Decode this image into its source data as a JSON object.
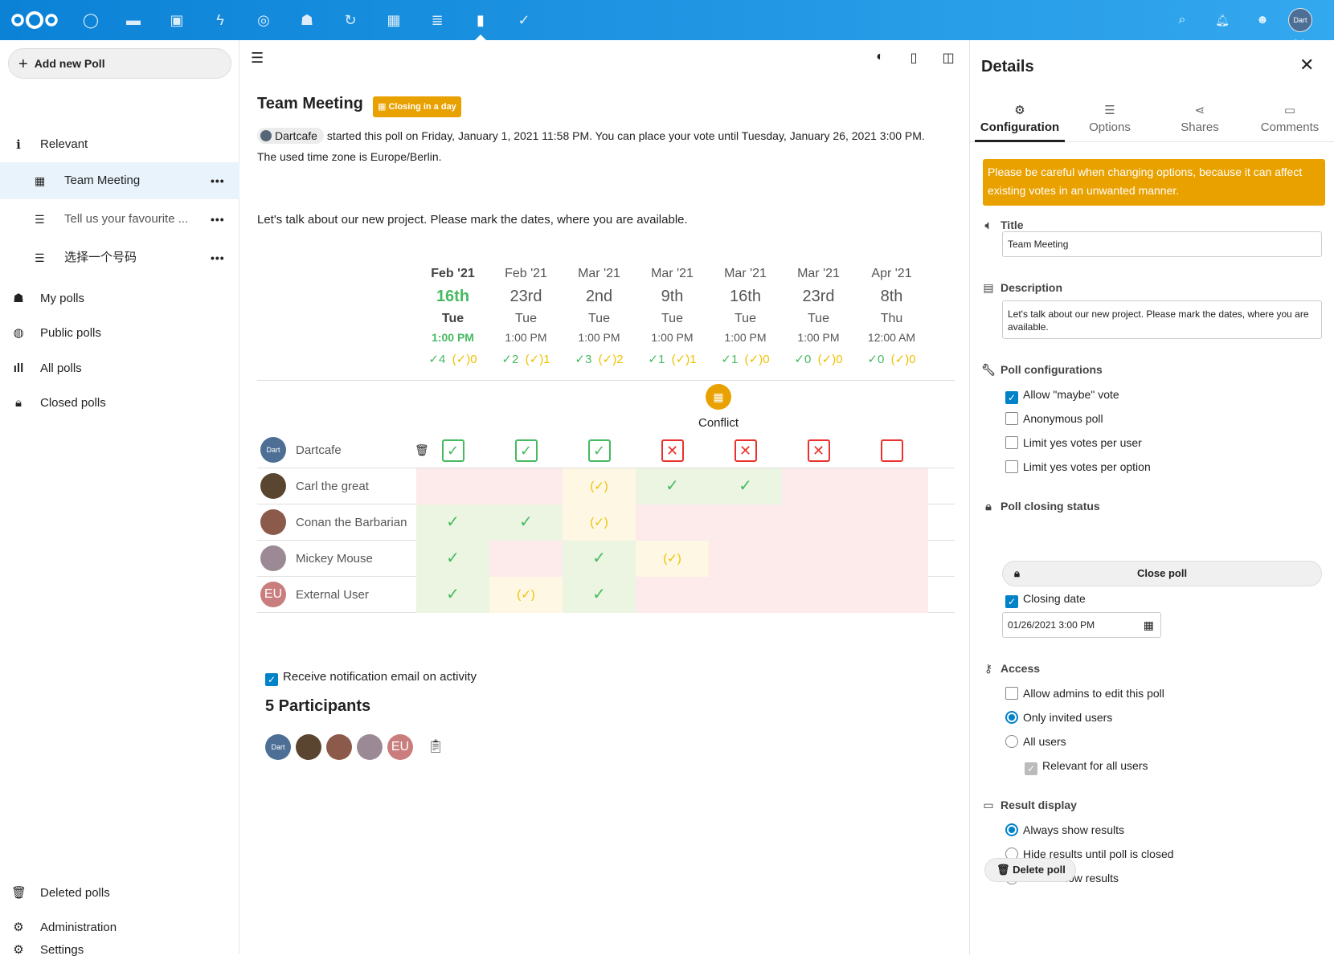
{
  "topbar": {
    "apps": [
      "dashboard-icon",
      "files-icon",
      "photos-icon",
      "activity-icon",
      "talk-icon",
      "contacts-icon",
      "circles-icon",
      "calendar-icon",
      "deck-icon",
      "polls-icon",
      "tasks-icon"
    ],
    "user_avatar_text": "Dart Cafe"
  },
  "leftnav": {
    "add_button": "Add new Poll",
    "relevant": "Relevant",
    "sub_items": [
      {
        "label": "Team Meeting",
        "dots": "•••"
      },
      {
        "label": "Tell us your favourite ...",
        "dots": "•••"
      },
      {
        "label": "选择一个号码",
        "dots": "•••"
      }
    ],
    "my_polls": "My polls",
    "public_polls": "Public polls",
    "all_polls": "All polls",
    "closed_polls": "Closed polls",
    "deleted_polls": "Deleted polls",
    "administration": "Administration",
    "settings": "Settings"
  },
  "poll": {
    "title": "Team Meeting",
    "badge": "Closing in a day",
    "author": "Dartcafe",
    "info_text": "started this poll on Friday, January 1, 2021 11:58 PM. You can place your vote until Tuesday, January 26, 2021 3:00 PM.",
    "timezone_text": "The used time zone is Europe/Berlin.",
    "description": "Let's talk about our new project. Please mark the dates, where you are available.",
    "options": [
      {
        "month": "Feb '21",
        "day": "16th",
        "weekday": "Tue",
        "time": "1:00 PM",
        "yes": "✓4",
        "maybe": "(✓)0"
      },
      {
        "month": "Feb '21",
        "day": "23rd",
        "weekday": "Tue",
        "time": "1:00 PM",
        "yes": "✓2",
        "maybe": "(✓)1"
      },
      {
        "month": "Mar '21",
        "day": "2nd",
        "weekday": "Tue",
        "time": "1:00 PM",
        "yes": "✓3",
        "maybe": "(✓)2"
      },
      {
        "month": "Mar '21",
        "day": "9th",
        "weekday": "Tue",
        "time": "1:00 PM",
        "yes": "✓1",
        "maybe": "(✓)1"
      },
      {
        "month": "Mar '21",
        "day": "16th",
        "weekday": "Tue",
        "time": "1:00 PM",
        "yes": "✓1",
        "maybe": "(✓)0"
      },
      {
        "month": "Mar '21",
        "day": "23rd",
        "weekday": "Tue",
        "time": "1:00 PM",
        "yes": "✓0",
        "maybe": "(✓)0"
      },
      {
        "month": "Apr '21",
        "day": "8th",
        "weekday": "Thu",
        "time": "12:00 AM",
        "yes": "✓0",
        "maybe": "(✓)0"
      }
    ],
    "conflict_label": "Conflict",
    "participants": [
      {
        "name": "Dartcafe",
        "avatar": "Dart",
        "color": "#4d6f95",
        "votes": [
          "yesbox",
          "yesbox",
          "yesbox",
          "nobox",
          "nobox",
          "nobox",
          "emptybox"
        ]
      },
      {
        "name": "Carl the great",
        "avatar": "",
        "color": "#5a4630",
        "votes": [
          "no",
          "no",
          "maybe",
          "yes",
          "yes",
          "no",
          "no"
        ]
      },
      {
        "name": "Conan the Barbarian",
        "avatar": "",
        "color": "#8c5a4a",
        "votes": [
          "yes",
          "yes",
          "maybe",
          "no",
          "no",
          "no",
          "no"
        ]
      },
      {
        "name": "Mickey Mouse",
        "avatar": "",
        "color": "#9b8a95",
        "votes": [
          "yes",
          "no",
          "yes",
          "maybe",
          "no",
          "no",
          "no"
        ]
      },
      {
        "name": "External User",
        "avatar": "EU",
        "color": "#c97d7d",
        "votes": [
          "yes",
          "maybe",
          "yes",
          "no",
          "no",
          "no",
          "no"
        ]
      }
    ],
    "notify_label": "Receive notification email on activity",
    "participants_title": "5 Participants",
    "maybe_symbol": "(✓)",
    "yes_symbol": "✓",
    "no_symbol": "✕"
  },
  "sidebar": {
    "title": "Details",
    "tabs": [
      "Configuration",
      "Options",
      "Shares",
      "Comments"
    ],
    "warning": "Please be careful when changing options, because it can affect existing votes in an unwanted manner.",
    "title_label": "Title",
    "title_value": "Team Meeting",
    "description_label": "Description",
    "description_value": "Let's talk about our new project. Please mark the dates, where you are available.",
    "poll_config_label": "Poll configurations",
    "config_options": [
      {
        "label": "Allow \"maybe\" vote",
        "checked": true
      },
      {
        "label": "Anonymous poll",
        "checked": false
      },
      {
        "label": "Limit yes votes per user",
        "checked": false
      },
      {
        "label": "Limit yes votes per option",
        "checked": false
      }
    ],
    "closing_status_label": "Poll closing status",
    "close_poll_button": "Close poll",
    "closing_date_label": "Closing date",
    "closing_date_value": "01/26/2021 3:00 PM",
    "access_label": "Access",
    "access_options": [
      "Allow admins to edit this poll",
      "Only invited users",
      "All users",
      "Relevant for all users"
    ],
    "result_display_label": "Result display",
    "result_options": [
      "Always show results",
      "Hide results until poll is closed",
      "Never show results"
    ],
    "delete_button": "Delete poll"
  }
}
